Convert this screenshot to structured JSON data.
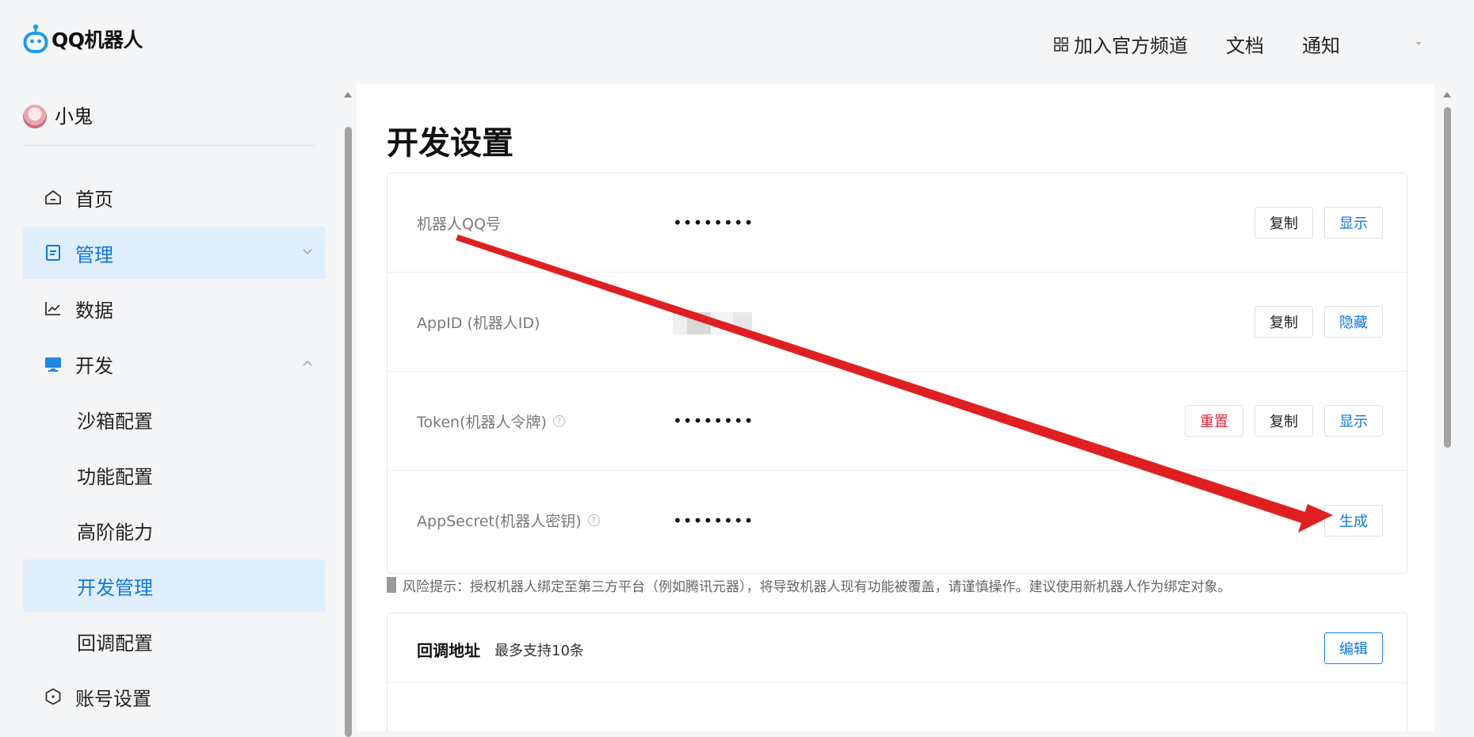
{
  "header": {
    "logo_text": "QQ机器人",
    "nav": {
      "join_channel": "加入官方频道",
      "docs": "文档",
      "notice": "通知"
    }
  },
  "sidebar": {
    "profile_name": "小鬼",
    "menu": {
      "home": "首页",
      "manage": "管理",
      "data": "数据",
      "develop": "开发",
      "sandbox": "沙箱配置",
      "features": "功能配置",
      "advanced": "高阶能力",
      "dev_manage": "开发管理",
      "callback": "回调配置",
      "account": "账号设置"
    }
  },
  "main": {
    "title": "开发设置",
    "credentials": [
      {
        "label": "机器人QQ号",
        "value": "••••••••",
        "actions": [
          "复制",
          "显示"
        ]
      },
      {
        "label": "AppID (机器人ID)",
        "value": "",
        "actions": [
          "复制",
          "隐藏"
        ]
      },
      {
        "label": "Token(机器人令牌)",
        "value": "••••••••",
        "actions": [
          "重置",
          "复制",
          "显示"
        ]
      },
      {
        "label": "AppSecret(机器人密钥)",
        "value": "••••••••",
        "actions": [
          "生成"
        ]
      }
    ],
    "help_icon": "?",
    "risk_tip": "风险提示：授权机器人绑定至第三方平台（例如腾讯元器），将导致机器人现有功能被覆盖，请谨慎操作。建议使用新机器人作为绑定对象。",
    "callback": {
      "title": "回调地址",
      "subtitle": "最多支持10条",
      "edit_label": "编辑"
    }
  },
  "colors": {
    "accent": "#0f77dc",
    "danger": "#e3273d",
    "annotation_arrow": "#e02020",
    "active_bg": "#dfeefc"
  }
}
